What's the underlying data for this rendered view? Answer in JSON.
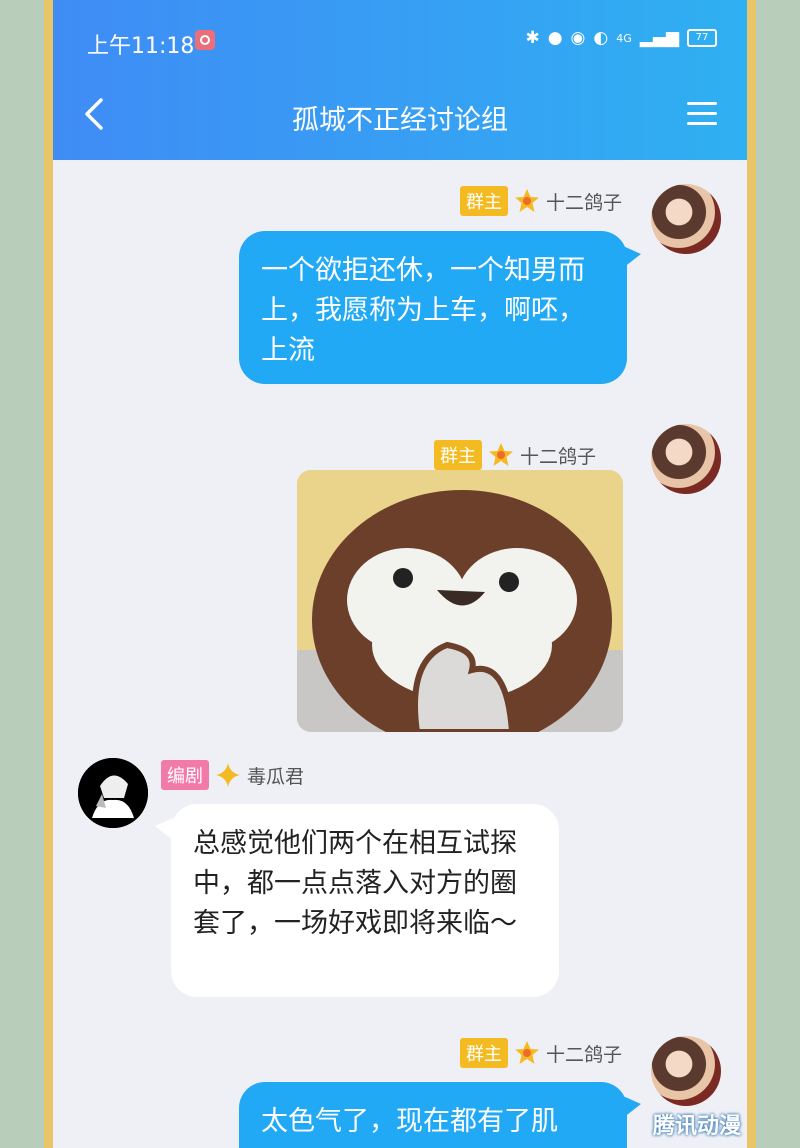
{
  "status": {
    "time": "上午11:18",
    "network": "4G",
    "battery": "77"
  },
  "header": {
    "title": "孤城不正经讨论组"
  },
  "messages": [
    {
      "role_badge": "群主",
      "sender": "十二鸽子",
      "text": "一个欲拒还休，一个知男而上，我愿称为上车，啊呸，上流"
    },
    {
      "role_badge": "群主",
      "sender": "十二鸽子",
      "sticker": "penguin-face"
    },
    {
      "role_badge": "编剧",
      "sender": "毒瓜君",
      "text": "总感觉他们两个在相互试探中，都一点点落入对方的圈套了，一场好戏即将来临～"
    },
    {
      "role_badge": "群主",
      "sender": "十二鸽子",
      "text": "太色气了，现在都有了肌"
    }
  ],
  "colors": {
    "header_start": "#3f8cf5",
    "header_end": "#2fb0f2",
    "bubble_blue": "#22a9f6",
    "badge_owner": "#f3bb21",
    "badge_writer": "#f27aa9"
  },
  "watermark": "腾讯动漫"
}
